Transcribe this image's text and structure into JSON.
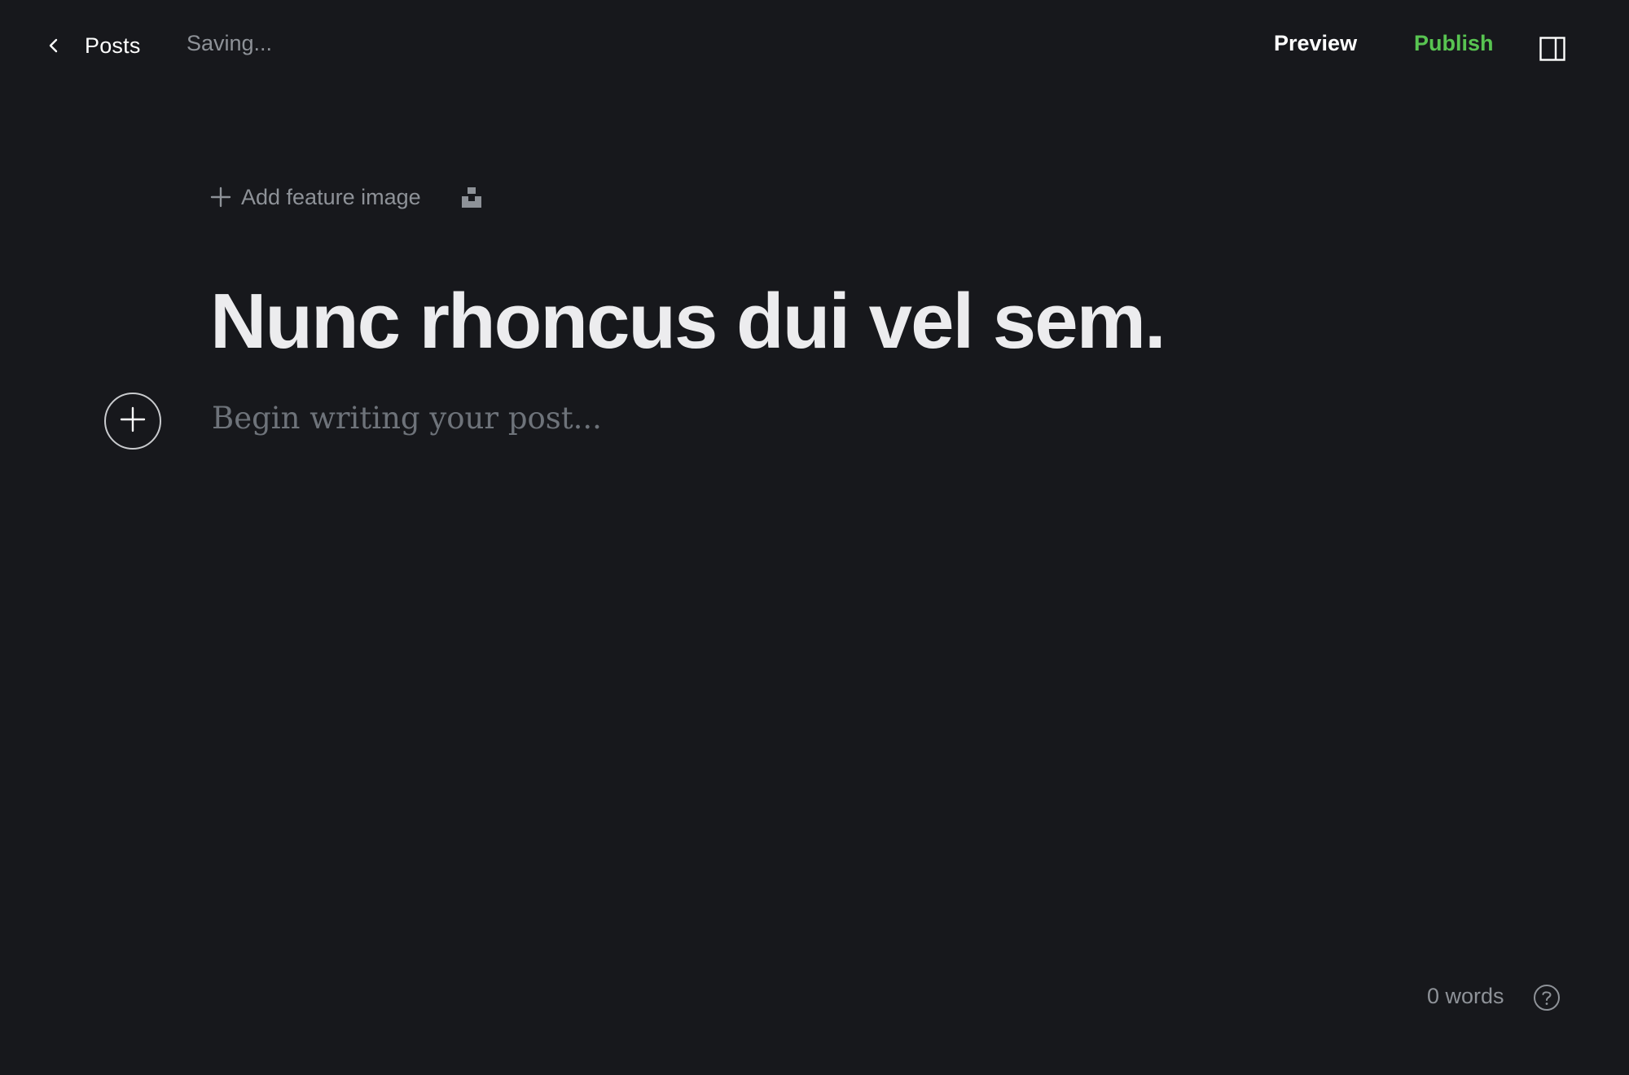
{
  "header": {
    "back_label": "Posts",
    "status": "Saving...",
    "preview_label": "Preview",
    "publish_label": "Publish",
    "publish_color": "#58c451"
  },
  "editor": {
    "feature_image_label": "Add feature image",
    "title": "Nunc rhoncus dui vel sem.",
    "body_placeholder": "Begin writing your post..."
  },
  "footer": {
    "word_count": "0 words"
  },
  "icons": {
    "back": "chevron-left-icon",
    "sidebar": "sidebar-panel-icon",
    "add_feature": "plus-icon",
    "unsplash": "unsplash-icon",
    "card_plus": "plus-icon",
    "help": "question-circle-icon"
  }
}
